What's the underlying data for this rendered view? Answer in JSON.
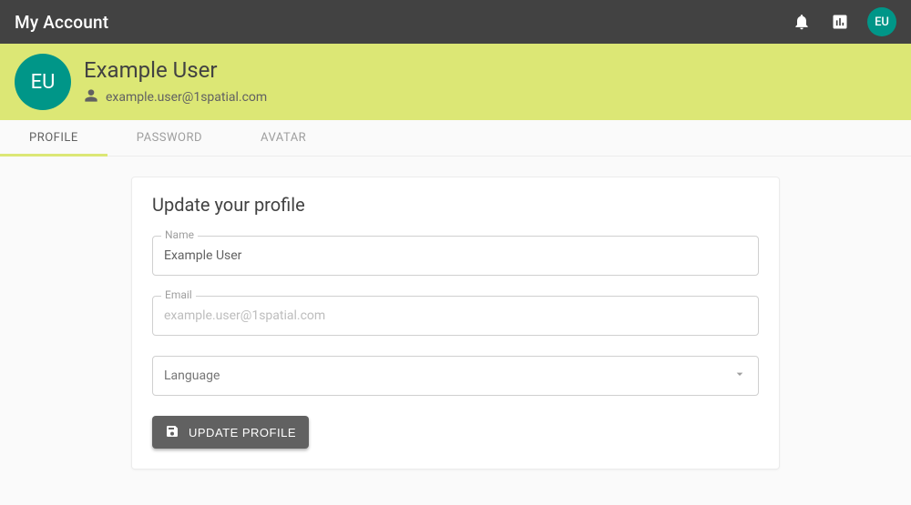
{
  "appbar": {
    "title": "My Account",
    "avatar_initials": "EU"
  },
  "header": {
    "avatar_initials": "EU",
    "name": "Example User",
    "email": "example.user@1spatial.com"
  },
  "tabs": [
    {
      "label": "PROFILE",
      "active": true
    },
    {
      "label": "PASSWORD",
      "active": false
    },
    {
      "label": "AVATAR",
      "active": false
    }
  ],
  "form": {
    "heading": "Update your profile",
    "name_label": "Name",
    "name_value": "Example User",
    "email_label": "Email",
    "email_value": "example.user@1spatial.com",
    "language_label": "Language",
    "submit_label": "UPDATE PROFILE"
  }
}
